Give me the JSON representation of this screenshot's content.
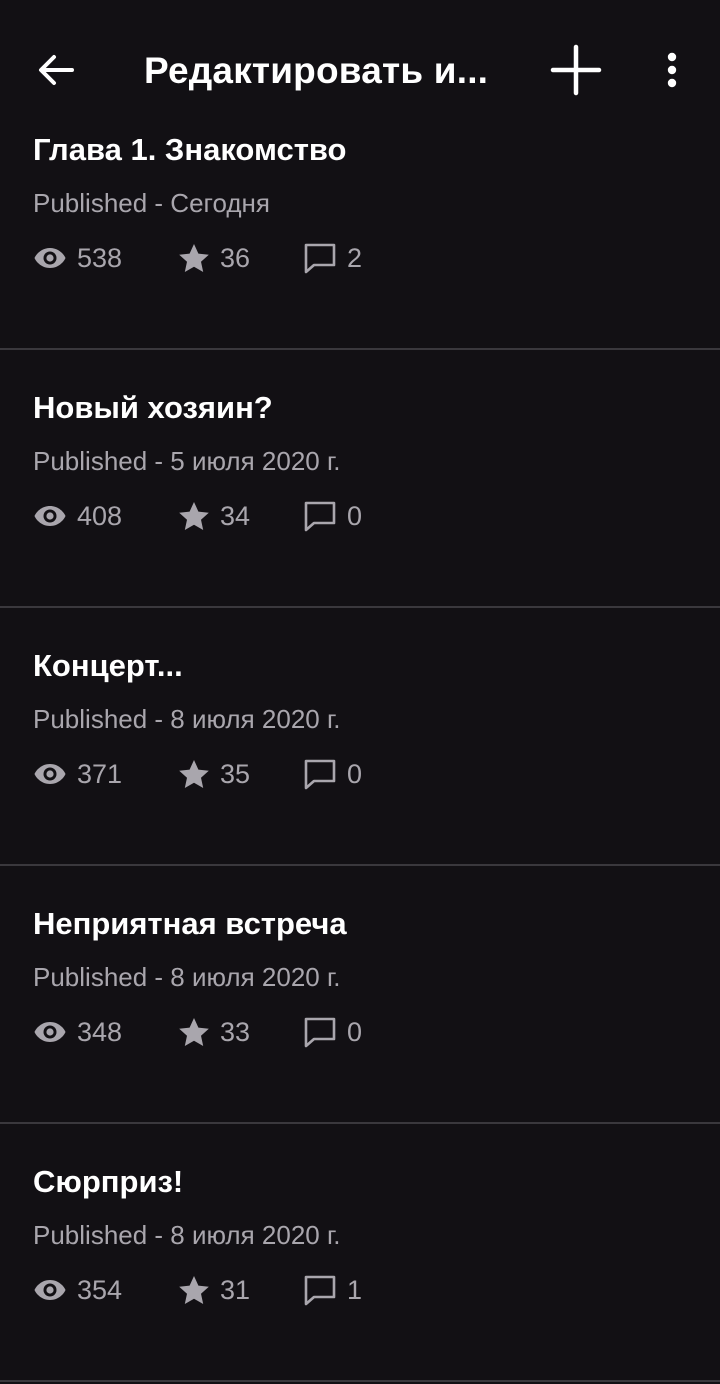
{
  "header": {
    "title": "Редактировать и...",
    "back_icon": "arrow-left-icon",
    "add_icon": "plus-icon",
    "menu_icon": "more-vertical-icon"
  },
  "parts": [
    {
      "title": "Глава 1. Знакомство",
      "status": "Published - Сегодня",
      "views": "538",
      "votes": "36",
      "comments": "2"
    },
    {
      "title": "Новый хозяин?",
      "status": "Published - 5 июля 2020 г.",
      "views": "408",
      "votes": "34",
      "comments": "0"
    },
    {
      "title": "Концерт...",
      "status": "Published - 8 июля 2020 г.",
      "views": "371",
      "votes": "35",
      "comments": "0"
    },
    {
      "title": "Неприятная встреча",
      "status": "Published - 8 июля 2020 г.",
      "views": "348",
      "votes": "33",
      "comments": "0"
    },
    {
      "title": "Сюрприз!",
      "status": "Published - 8 июля 2020 г.",
      "views": "354",
      "votes": "31",
      "comments": "1"
    }
  ],
  "colors": {
    "background": "#121014",
    "divider": "#3a383d",
    "secondary_text": "#a9a6ad"
  }
}
